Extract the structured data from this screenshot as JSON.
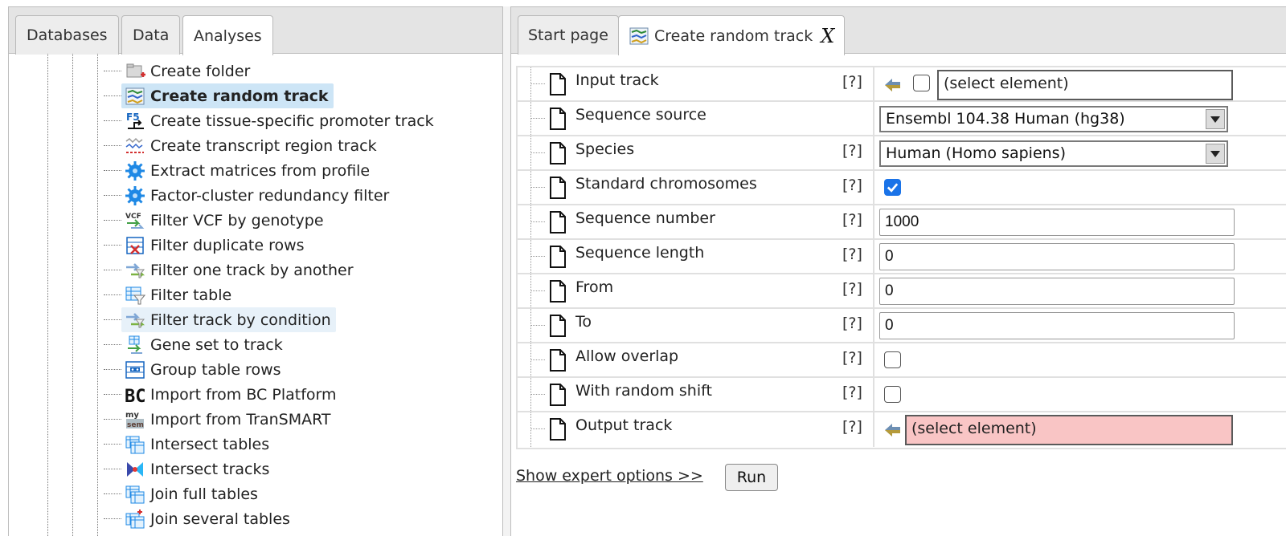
{
  "left": {
    "tabs": [
      "Databases",
      "Data",
      "Analyses"
    ],
    "active_tab": "Analyses",
    "items": [
      {
        "label": "Create folder",
        "icon": "folder-add-icon",
        "state": ""
      },
      {
        "label": "Create random track",
        "icon": "random-track-icon",
        "state": "selected"
      },
      {
        "label": "Create tissue-specific promoter track",
        "icon": "f5-promoter-icon",
        "state": ""
      },
      {
        "label": "Create transcript region track",
        "icon": "transcript-region-icon",
        "state": ""
      },
      {
        "label": "Extract matrices from profile",
        "icon": "blue-gear-icon",
        "state": ""
      },
      {
        "label": "Factor-cluster redundancy filter",
        "icon": "blue-gear-icon",
        "state": ""
      },
      {
        "label": "Filter VCF by genotype",
        "icon": "vcf-filter-icon",
        "state": ""
      },
      {
        "label": "Filter duplicate rows",
        "icon": "duplicate-rows-icon",
        "state": ""
      },
      {
        "label": "Filter one track by another",
        "icon": "filter-track-icon",
        "state": ""
      },
      {
        "label": "Filter table",
        "icon": "filter-table-icon",
        "state": ""
      },
      {
        "label": "Filter track by condition",
        "icon": "filter-track-icon",
        "state": "hover"
      },
      {
        "label": "Gene set to track",
        "icon": "gene-set-icon",
        "state": ""
      },
      {
        "label": "Group table rows",
        "icon": "group-rows-icon",
        "state": ""
      },
      {
        "label": "Import from BC Platform",
        "icon": "bc-logo-icon",
        "state": ""
      },
      {
        "label": "Import from TranSMART",
        "icon": "transmart-icon",
        "state": ""
      },
      {
        "label": "Intersect tables",
        "icon": "table-icon",
        "state": ""
      },
      {
        "label": "Intersect tracks",
        "icon": "intersect-tracks-icon",
        "state": ""
      },
      {
        "label": "Join full tables",
        "icon": "table-icon",
        "state": ""
      },
      {
        "label": "Join several tables",
        "icon": "join-tables-icon",
        "state": ""
      }
    ]
  },
  "right": {
    "tabs": [
      {
        "label": "Start page"
      },
      {
        "label": "Create random track",
        "close": "X"
      }
    ],
    "params": [
      {
        "name": "Input track",
        "help": "[?]",
        "type": "select-element",
        "value": "(select element)",
        "checked": false
      },
      {
        "name": "Sequence source",
        "help": "",
        "type": "select",
        "value": "Ensembl 104.38 Human (hg38)"
      },
      {
        "name": "Species",
        "help": "[?]",
        "type": "select",
        "value": "Human (Homo sapiens)"
      },
      {
        "name": "Standard chromosomes",
        "help": "[?]",
        "type": "checkbox",
        "checked": true
      },
      {
        "name": "Sequence number",
        "help": "[?]",
        "type": "text",
        "value": "1000"
      },
      {
        "name": "Sequence length",
        "help": "[?]",
        "type": "text",
        "value": "0"
      },
      {
        "name": "From",
        "help": "[?]",
        "type": "text",
        "value": "0"
      },
      {
        "name": "To",
        "help": "[?]",
        "type": "text",
        "value": "0"
      },
      {
        "name": "Allow overlap",
        "help": "[?]",
        "type": "checkbox",
        "checked": false
      },
      {
        "name": "With random shift",
        "help": "[?]",
        "type": "checkbox",
        "checked": false
      },
      {
        "name": "Output track",
        "help": "[?]",
        "type": "output-element",
        "value": "(select element)"
      }
    ],
    "expert_link": "Show expert options >>",
    "run_label": "Run"
  },
  "colors": {
    "selected_bg": "#cde5f6",
    "error_bg": "#f9c5c5",
    "checkbox_blue": "#1a73e8"
  }
}
